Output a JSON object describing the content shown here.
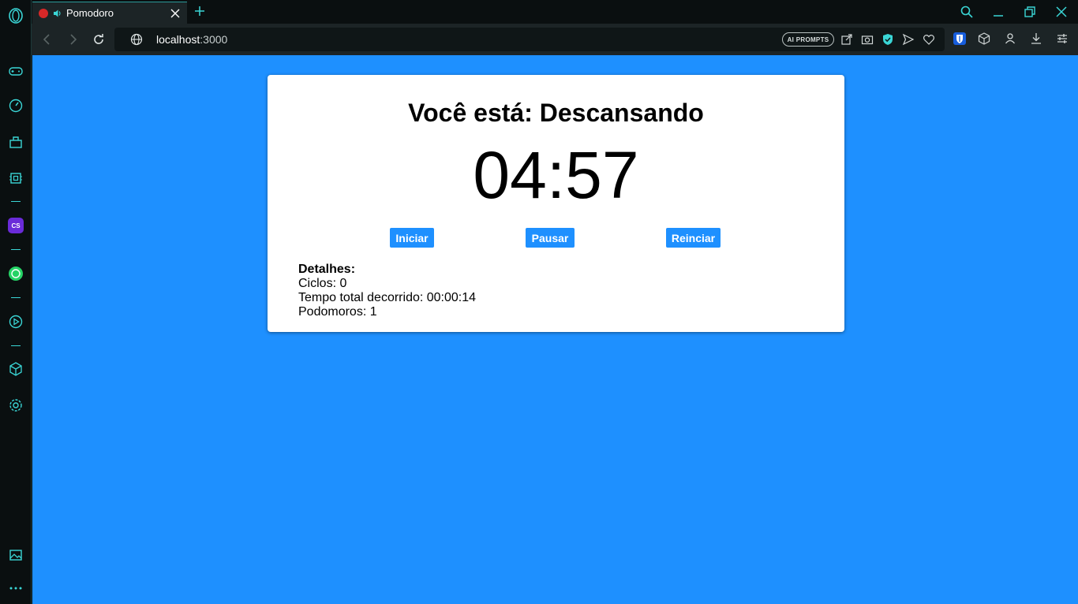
{
  "browser": {
    "tab_title": "Pomodoro",
    "url_host": "localhost",
    "url_port": ":3000",
    "ai_prompts_label": "AI PROMPTS",
    "accent_color": "#3ad6d6"
  },
  "sidebar": {
    "items": [
      "game-controller-icon",
      "speedometer-icon",
      "bag-icon",
      "chip-icon",
      "cs-app-icon",
      "whatsapp-icon",
      "player-icon",
      "cube-icon",
      "settings-icon"
    ],
    "cs_label": "CS"
  },
  "app": {
    "background_color": "#1e90ff",
    "status_text": "Você está: Descansando",
    "timer": "04:57",
    "buttons": {
      "start": "Iniciar",
      "pause": "Pausar",
      "reset": "Reinciar"
    },
    "details": {
      "heading": "Detalhes:",
      "cycles": "Ciclos: 0",
      "elapsed": "Tempo total decorrido: 00:00:14",
      "pomodoros": "Podomoros: 1"
    }
  }
}
